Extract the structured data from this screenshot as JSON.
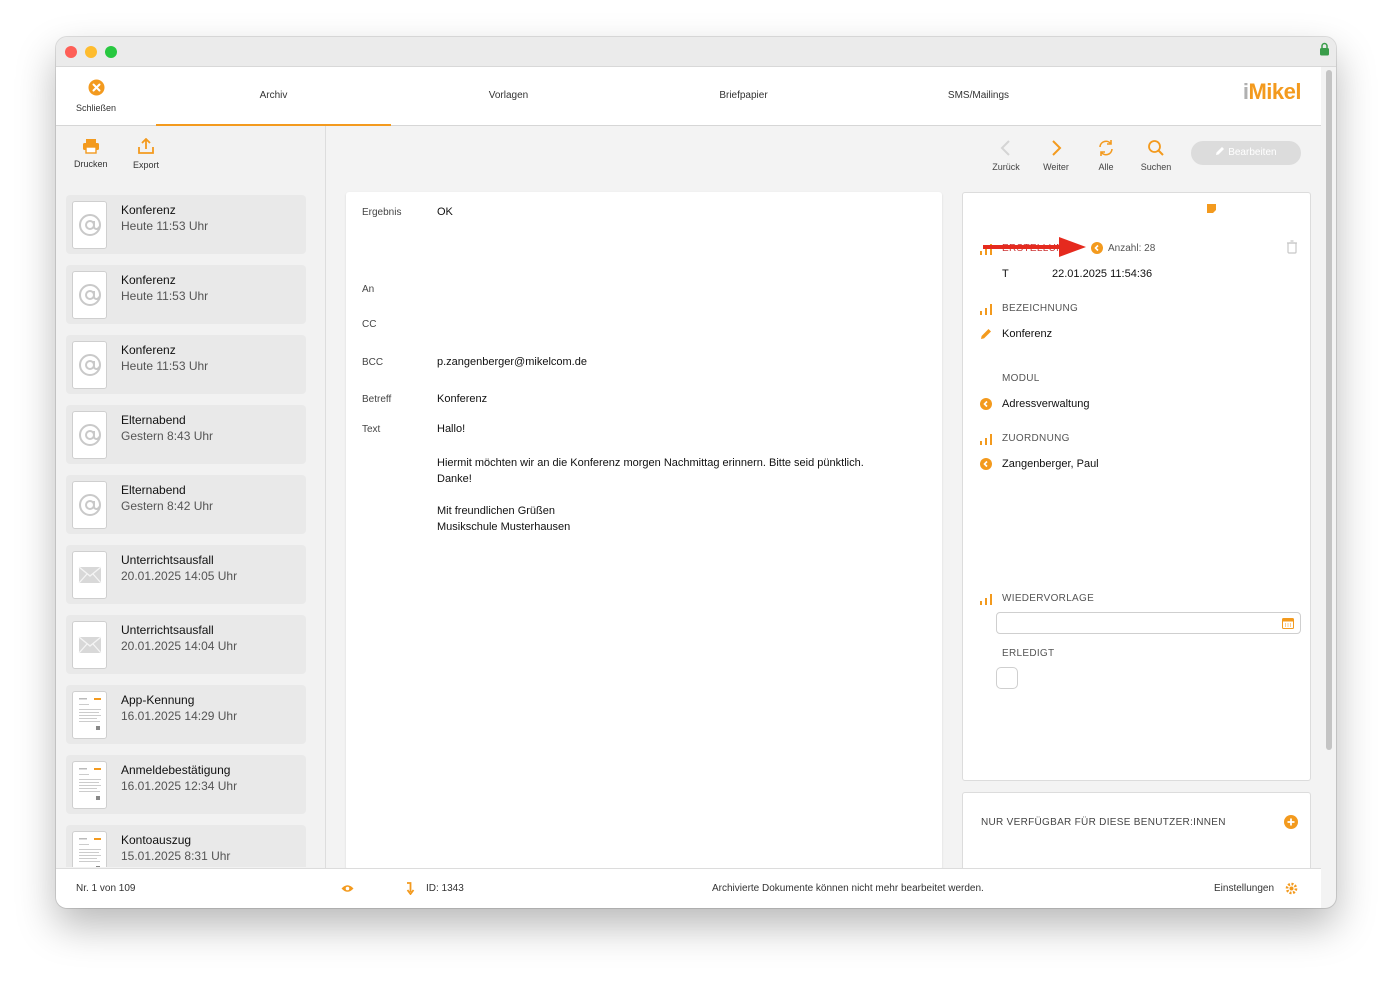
{
  "toolbar": {
    "close_label": "Schließen"
  },
  "tabs": [
    {
      "label": "Archiv"
    },
    {
      "label": "Vorlagen"
    },
    {
      "label": "Briefpapier"
    },
    {
      "label": "SMS/Mailings"
    }
  ],
  "logo": {
    "prefix": "i",
    "text": "Mikel"
  },
  "left_tools": {
    "print_label": "Drucken",
    "export_label": "Export"
  },
  "list": [
    {
      "title": "Konferenz",
      "subtitle": "Heute 11:53 Uhr",
      "type": "at-icon"
    },
    {
      "title": "Konferenz",
      "subtitle": "Heute 11:53 Uhr",
      "type": "at-icon"
    },
    {
      "title": "Konferenz",
      "subtitle": "Heute 11:53 Uhr",
      "type": "at-icon"
    },
    {
      "title": "Elternabend",
      "subtitle": "Gestern 8:43 Uhr",
      "type": "at-icon"
    },
    {
      "title": "Elternabend",
      "subtitle": "Gestern 8:42 Uhr",
      "type": "at-icon"
    },
    {
      "title": "Unterrichtsausfall",
      "subtitle": "20.01.2025 14:05 Uhr",
      "type": "envelope-icon"
    },
    {
      "title": "Unterrichtsausfall",
      "subtitle": "20.01.2025 14:04 Uhr",
      "type": "envelope-icon"
    },
    {
      "title": "App-Kennung",
      "subtitle": "16.01.2025 14:29 Uhr",
      "type": "document-thumbnail"
    },
    {
      "title": "Anmeldebestätigung",
      "subtitle": "16.01.2025 12:34 Uhr",
      "type": "document-thumbnail"
    },
    {
      "title": "Kontoauszug",
      "subtitle": "15.01.2025 8:31 Uhr",
      "type": "document-thumbnail"
    }
  ],
  "nav": {
    "back_label": "Zurück",
    "forward_label": "Weiter",
    "all_label": "Alle",
    "search_label": "Suchen",
    "edit_label": "Bearbeiten"
  },
  "mail": {
    "result_label": "Ergebnis",
    "result_value": "OK",
    "to_label": "An",
    "to_value": "",
    "cc_label": "CC",
    "cc_value": "",
    "bcc_label": "BCC",
    "bcc_value": "p.zangenberger@mikelcom.de",
    "subject_label": "Betreff",
    "subject_value": "Konferenz",
    "text_label": "Text",
    "body": {
      "greeting": "Hallo!",
      "line1": "Hiermit möchten wir an die Konferenz morgen Nachmittag erinnern. Bitte seid pünktlich.",
      "line2": "Danke!",
      "closing1": "Mit freundlichen Grüßen",
      "closing2": "Musikschule Musterhausen"
    }
  },
  "detail": {
    "creation_label": "ERSTELLUNG",
    "count_label": "Anzahl: 28",
    "type_value": "T",
    "creation_value": "22.01.2025 11:54:36",
    "designation_label": "BEZEICHNUNG",
    "designation_value": "Konferenz",
    "module_label": "MODUL",
    "module_value": "Adressverwaltung",
    "assignment_label": "ZUORDNUNG",
    "assignment_value": "Zangenberger, Paul",
    "followup_label": "WIEDERVORLAGE",
    "followup_value": "",
    "done_label": "ERLEDIGT",
    "done_checked": false
  },
  "users": {
    "label": "NUR VERFÜGBAR FÜR DIESE BENUTZER:INNEN"
  },
  "status": {
    "record": "Nr. 1 von 109",
    "id": "ID: 1343",
    "message": "Archivierte Dokumente können nicht mehr bearbeitet werden.",
    "settings_label": "Einstellungen"
  },
  "colors": {
    "accent": "#f39a1e",
    "annotation_arrow": "#e52a1e"
  }
}
